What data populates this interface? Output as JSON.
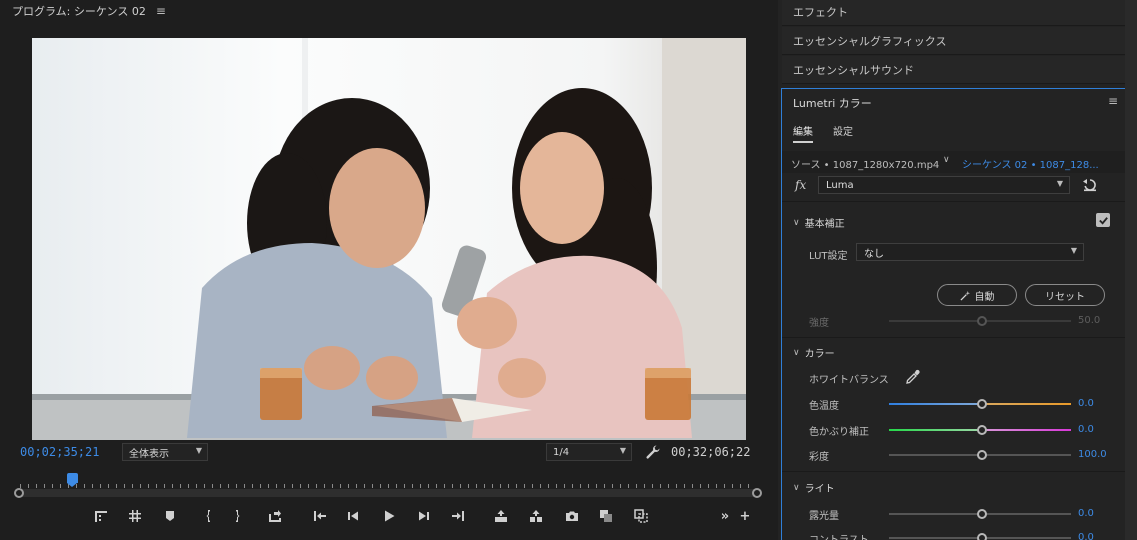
{
  "program": {
    "title": "プログラム: シーケンス 02",
    "menu_icon": "≡",
    "current_timecode": "00;02;35;21",
    "total_timecode": "00;32;06;22",
    "fit_dropdown": "全体表示",
    "resolution_dropdown": "1/4",
    "transport": {
      "more": "»",
      "add": "+"
    }
  },
  "panels": {
    "effects": "エフェクト",
    "essential_graphics": "エッセンシャルグラフィックス",
    "essential_sound": "エッセンシャルサウンド"
  },
  "lumetri": {
    "title": "Lumetri カラー",
    "menu_icon": "≡",
    "tabs": [
      "編集",
      "設定"
    ],
    "source": "ソース • 1087_1280x720.mp4",
    "sequence": "シーケンス 02 • 1087_128...",
    "fx_label": "fx",
    "effect_dropdown": "Luma",
    "basic": {
      "heading": "基本補正",
      "checked": true,
      "lut_label": "LUT設定",
      "lut_value": "なし",
      "auto_label": "自動",
      "reset_label": "リセット",
      "intensity_label": "強度",
      "intensity_value": "50.0"
    },
    "color": {
      "heading": "カラー",
      "white_balance": "ホワイトバランス",
      "temperature_label": "色温度",
      "temperature_value": "0.0",
      "tint_label": "色かぶり補正",
      "tint_value": "0.0",
      "saturation_label": "彩度",
      "saturation_value": "100.0"
    },
    "light": {
      "heading": "ライト",
      "exposure_label": "露光量",
      "exposure_value": "0.0",
      "contrast_label": "コントラスト",
      "contrast_value": "0.0"
    }
  },
  "colors": {
    "accent_blue": "#3d8be6",
    "panel_border": "#2f7fd8"
  }
}
